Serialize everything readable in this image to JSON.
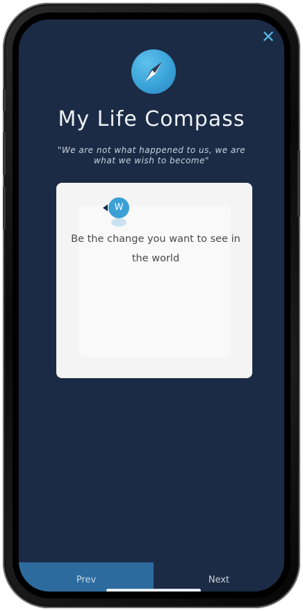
{
  "app": {
    "close_icon": "close-icon",
    "compass_icon": "compass-icon",
    "title": "My Life Compass",
    "quote": "\"We are not what happened to us, we are what we wish to become\""
  },
  "card": {
    "badge_letter": "W",
    "text": "Be the change you want to see in the world"
  },
  "footer": {
    "prev_label": "Prev",
    "next_label": "Next"
  },
  "colors": {
    "background": "#1c2b45",
    "accent": "#3aa0d6",
    "prev_button": "#2d6b9f",
    "card": "#f4f4f5"
  }
}
